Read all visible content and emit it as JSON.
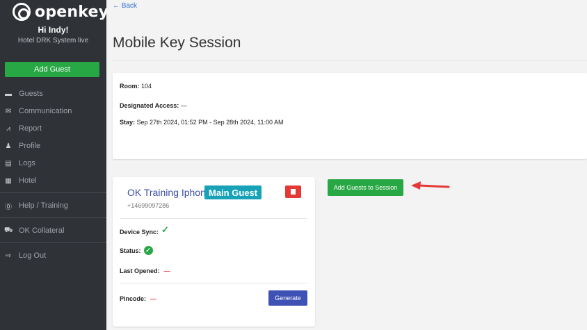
{
  "sidebar": {
    "logo_text": "openkey",
    "greeting": "Hi Indy!",
    "hotel": "Hotel DRK System live",
    "add_guest_label": "Add Guest",
    "items": [
      {
        "label": "Guests",
        "icon": "bed-icon"
      },
      {
        "label": "Communication",
        "icon": "envelope-icon"
      },
      {
        "label": "Report",
        "icon": "chart-icon"
      },
      {
        "label": "Profile",
        "icon": "user-icon"
      },
      {
        "label": "Logs",
        "icon": "list-icon"
      },
      {
        "label": "Hotel",
        "icon": "building-icon"
      },
      {
        "label": "Help / Training",
        "icon": "help-icon"
      },
      {
        "label": "OK Collateral",
        "icon": "cart-icon"
      },
      {
        "label": "Log Out",
        "icon": "logout-icon"
      }
    ]
  },
  "main": {
    "back_label": "← Back",
    "title": "Mobile Key Session",
    "info": {
      "room_label": "Room:",
      "room_value": "104",
      "access_label": "Designated Access:",
      "access_value": "—",
      "stay_label": "Stay:",
      "stay_value": "Sep 27th 2024, 01:52 PM - Sep 28th 2024, 11:00 AM"
    },
    "guest": {
      "name": "OK Training Iphone",
      "badge": "Main Guest",
      "phone": "+14699097286",
      "device_sync_label": "Device Sync:",
      "status_label": "Status:",
      "last_opened_label": "Last Opened:",
      "last_opened_value": "—",
      "pincode_label": "Pincode:",
      "pincode_value": "—",
      "generate_label": "Generate"
    },
    "add_session_label": "Add Guests to Session"
  },
  "colors": {
    "sidebar_bg": "#2f3237",
    "primary_green": "#28a745",
    "badge_teal": "#17a2b8",
    "danger_red": "#e53935",
    "indigo": "#3f51b5",
    "link_blue": "#2d6fd3"
  }
}
